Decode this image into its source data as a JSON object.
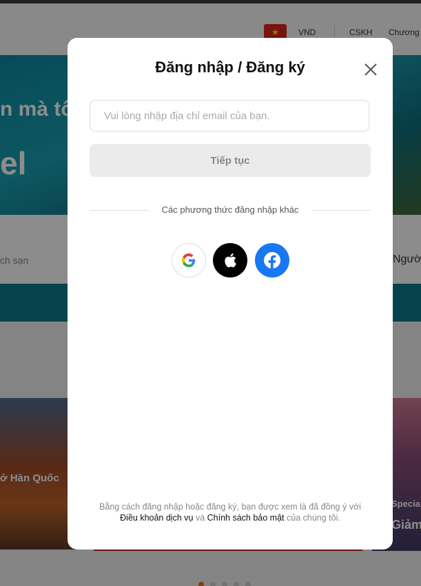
{
  "background": {
    "header": {
      "flag_label": "★",
      "currency": "VND",
      "support": "CSKH",
      "promo": "Chương"
    },
    "hero": {
      "line1": "n mà tôi",
      "line2": "el"
    },
    "search": {
      "left_hint": "ch sạn",
      "right_hint": "Ngườ"
    },
    "cards": {
      "left_caption": "ở Hàn Quốc",
      "right_caption1": "Specia",
      "right_caption2": "Giảm"
    },
    "carousel_dots": 5,
    "active_dot": 0
  },
  "modal": {
    "title": "Đăng nhập / Đăng ký",
    "email_placeholder": "Vui lòng nhập địa chỉ email của bạn.",
    "email_value": "",
    "continue_label": "Tiếp tục",
    "divider_text": "Các phương thức đăng nhập khác",
    "social": [
      {
        "name": "google",
        "icon": "google-icon"
      },
      {
        "name": "apple",
        "icon": "apple-icon"
      },
      {
        "name": "facebook",
        "icon": "facebook-icon"
      }
    ],
    "terms_prefix": "Bằng cách đăng nhập hoặc đăng ký, bạn được xem là đã đồng ý với",
    "terms_link": "Điều khoản dịch vụ",
    "terms_and": "và",
    "privacy_link": "Chính sách bảo mật",
    "terms_suffix": "của chúng tôi."
  },
  "colors": {
    "facebook": "#1877f2",
    "apple": "#000000",
    "accent": "#f36f21"
  }
}
